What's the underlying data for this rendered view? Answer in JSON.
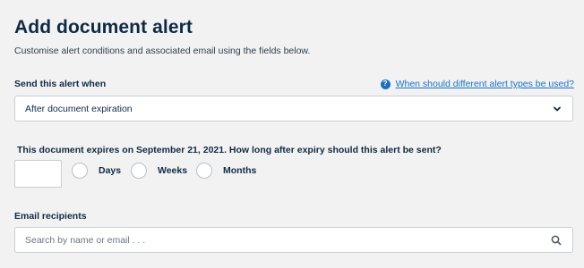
{
  "header": {
    "title": "Add document alert",
    "subtitle": "Customise alert conditions and associated email using the fields below."
  },
  "alert_type": {
    "label": "Send this alert when",
    "help_link": "When should different alert types be used?",
    "help_icon": "question-circle-icon",
    "selected": "After document expiration",
    "dropdown_icon": "chevron-down-icon"
  },
  "timing": {
    "question": "This document expires on September 21, 2021. How long after expiry should this alert be sent?",
    "amount_value": "",
    "units": [
      {
        "label": "Days",
        "selected": false
      },
      {
        "label": "Weeks",
        "selected": false
      },
      {
        "label": "Months",
        "selected": false
      }
    ]
  },
  "recipients": {
    "label": "Email recipients",
    "placeholder": "Search by name or email . . .",
    "search_icon": "search-icon"
  },
  "colors": {
    "background": "#f2f2f2",
    "heading": "#0f2a44",
    "link": "#1a73c8",
    "help_icon": "#1a6fc4",
    "border": "#c9ced4"
  }
}
